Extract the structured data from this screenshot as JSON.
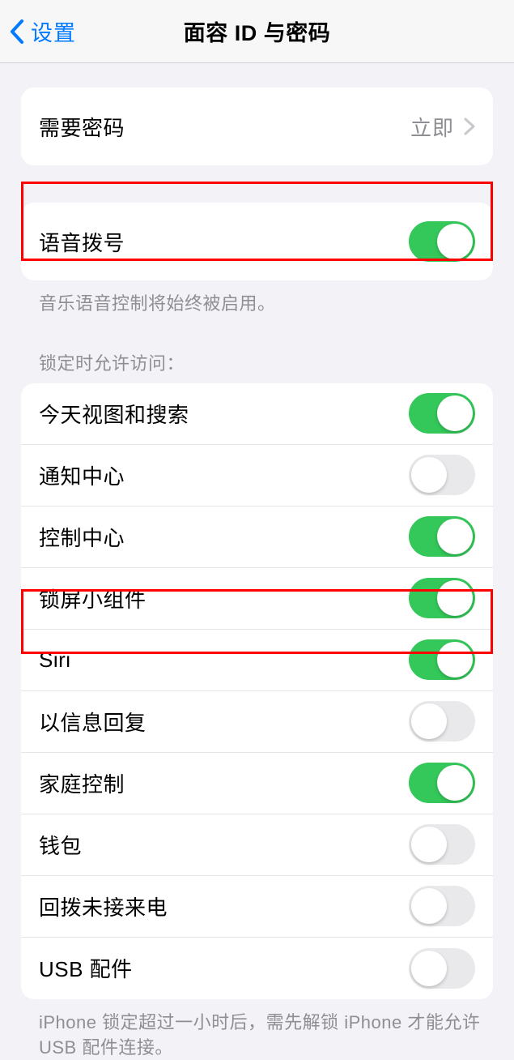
{
  "nav": {
    "back_label": "设置",
    "title": "面容 ID 与密码"
  },
  "passcode_group": {
    "require_passcode": {
      "label": "需要密码",
      "value": "立即"
    }
  },
  "voice_dial": {
    "label": "语音拨号",
    "footer": "音乐语音控制将始终被启用。",
    "on": true
  },
  "lock_section_header": "锁定时允许访问：",
  "lock_items": [
    {
      "label": "今天视图和搜索",
      "on": true
    },
    {
      "label": "通知中心",
      "on": false
    },
    {
      "label": "控制中心",
      "on": true
    },
    {
      "label": "锁屏小组件",
      "on": true
    },
    {
      "label": "Siri",
      "on": true
    },
    {
      "label": "以信息回复",
      "on": false
    },
    {
      "label": "家庭控制",
      "on": true
    },
    {
      "label": "钱包",
      "on": false
    },
    {
      "label": "回拨未接来电",
      "on": false
    },
    {
      "label": "USB 配件",
      "on": false
    }
  ],
  "usb_footer": "iPhone 锁定超过一小时后，需先解锁 iPhone 才能允许 USB 配件连接。"
}
